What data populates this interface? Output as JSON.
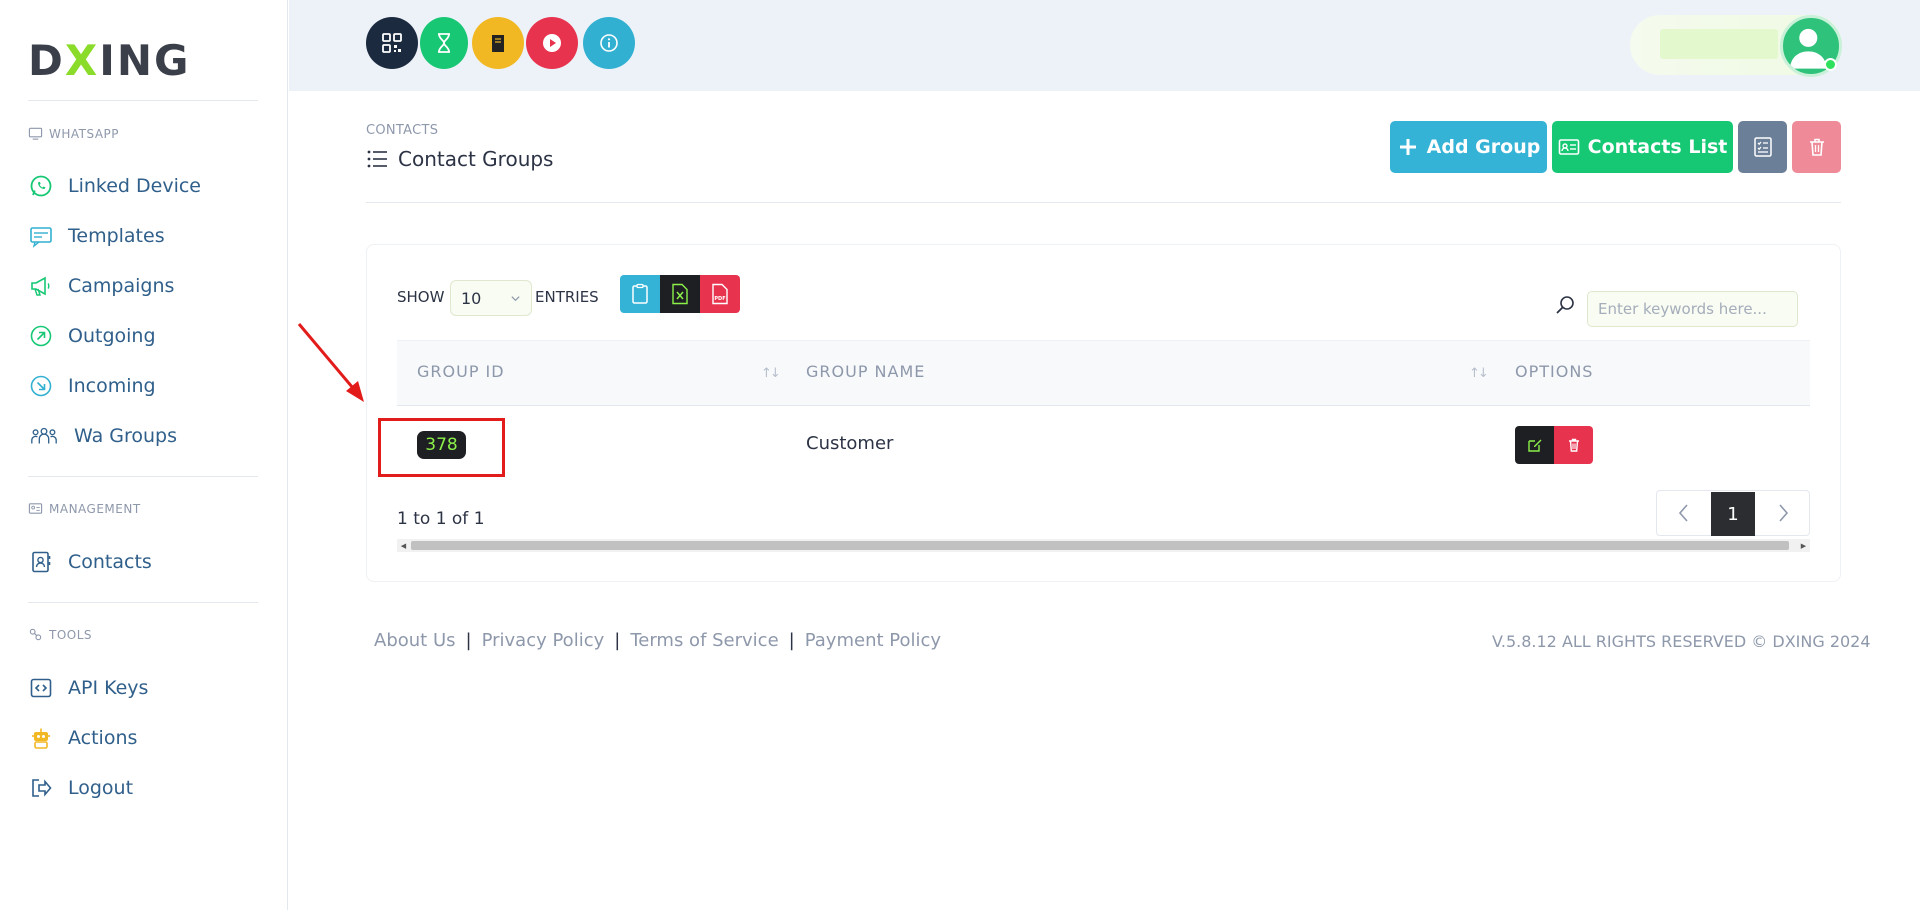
{
  "brand": {
    "logo_prefix": "D",
    "logo_x": "X",
    "logo_suffix": "ING"
  },
  "sidebar": {
    "sections": [
      {
        "title": "WHATSAPP",
        "icon": "monitor-icon"
      },
      {
        "title": "MANAGEMENT",
        "icon": "id-card-icon"
      },
      {
        "title": "TOOLS",
        "icon": "tools-icon"
      }
    ],
    "items": [
      {
        "label": "Linked Device",
        "icon": "whatsapp-icon"
      },
      {
        "label": "Templates",
        "icon": "message-template-icon"
      },
      {
        "label": "Campaigns",
        "icon": "megaphone-icon"
      },
      {
        "label": "Outgoing",
        "icon": "arrow-up-right-circle-icon"
      },
      {
        "label": "Incoming",
        "icon": "arrow-down-right-circle-icon"
      },
      {
        "label": "Wa Groups",
        "icon": "people-group-icon"
      },
      {
        "label": "Contacts",
        "icon": "contact-book-icon"
      },
      {
        "label": "API Keys",
        "icon": "code-icon"
      },
      {
        "label": "Actions",
        "icon": "robot-icon"
      },
      {
        "label": "Logout",
        "icon": "logout-icon"
      }
    ]
  },
  "topbar": {
    "buttons": [
      {
        "icon": "qr-code-icon",
        "color": "#1b2a3f"
      },
      {
        "icon": "hourglass-icon",
        "color": "#18c774"
      },
      {
        "icon": "book-icon",
        "color": "#f2b824"
      },
      {
        "icon": "play-icon",
        "color": "#e8334f"
      },
      {
        "icon": "info-icon",
        "color": "#32b0d1"
      }
    ]
  },
  "header": {
    "breadcrumb": "CONTACTS",
    "title": "Contact Groups",
    "add_group_label": "Add Group",
    "contacts_list_label": "Contacts List"
  },
  "table": {
    "show_label": "SHOW",
    "page_size": "10",
    "entries_label": "ENTRIES",
    "search_placeholder": "Enter keywords here...",
    "columns": [
      "GROUP ID",
      "GROUP NAME",
      "OPTIONS"
    ],
    "rows": [
      {
        "group_id": "378",
        "group_name": "Customer"
      }
    ],
    "info": "1 to 1 of 1",
    "current_page": "1"
  },
  "footer": {
    "links": [
      "About Us",
      "Privacy Policy",
      "Terms of Service",
      "Payment Policy"
    ],
    "separator": "|",
    "copyright": "V.5.8.12 ALL RIGHTS RESERVED © DXING 2024"
  },
  "colors": {
    "accent_blue": "#34b3d6",
    "accent_green": "#16c874",
    "slate": "#6b7f99",
    "danger": "#e9334f",
    "highlight": "#e21b1b"
  }
}
